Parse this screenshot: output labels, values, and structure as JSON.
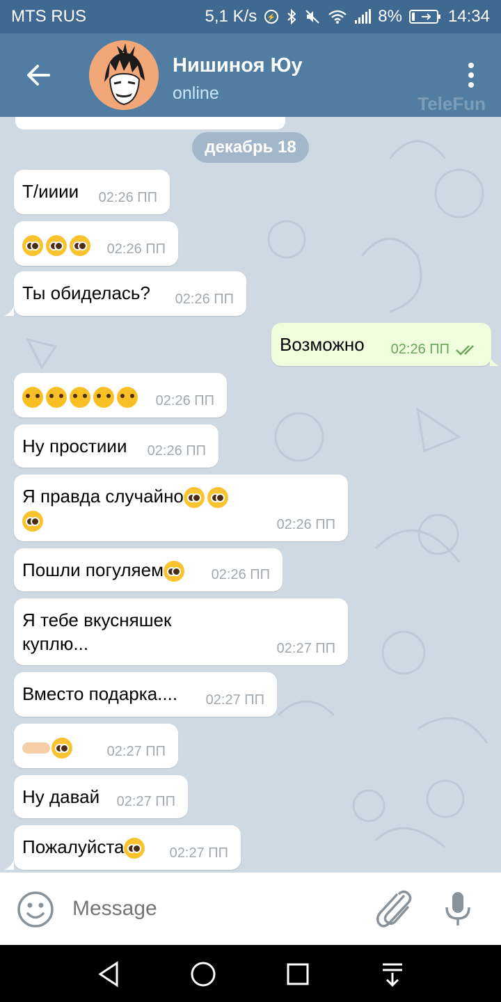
{
  "status_bar": {
    "carrier": "MTS RUS",
    "speed": "5,1 K/s",
    "battery": "8%",
    "time": "14:34",
    "icons": [
      "speed-icon",
      "bluetooth-icon",
      "mute-icon",
      "wifi-icon",
      "signal-icon",
      "battery-icon"
    ]
  },
  "header": {
    "title": "Нишиноя Юу",
    "status": "online",
    "watermark": "TeleFun"
  },
  "chat": {
    "date_divider": "декабрь 18",
    "messages": [
      {
        "text": "Т/ииии",
        "time": "02:26 ПП",
        "out": false
      },
      {
        "text": "",
        "emoji": [
          "pleading-face",
          "pleading-face",
          "pleading-face"
        ],
        "time": "02:26 ПП",
        "out": false
      },
      {
        "text": "Ты обиделась?",
        "time": "02:26 ПП",
        "out": false
      },
      {
        "text": "Возможно",
        "time": "02:26 ПП",
        "out": true,
        "status": "read"
      },
      {
        "text": "",
        "emoji": [
          "loudly-crying-face",
          "loudly-crying-face",
          "loudly-crying-face",
          "loudly-crying-face",
          "loudly-crying-face"
        ],
        "time": "02:26 ПП",
        "out": false
      },
      {
        "text": "Ну простиии",
        "time": "02:26 ПП",
        "out": false
      },
      {
        "text": "Я правда случайно",
        "emoji": [
          "pleading-face",
          "pleading-face",
          "pleading-face"
        ],
        "time": "02:26 ПП",
        "out": false
      },
      {
        "text": "Пошли погуляем",
        "emoji": [
          "pleading-face"
        ],
        "time": "02:26 ПП",
        "out": false
      },
      {
        "text_line1": "Я тебе вкусняшек",
        "text_line2": "куплю...",
        "time": "02:27 ПП",
        "out": false
      },
      {
        "text": "Вместо подарка....",
        "time": "02:27 ПП",
        "out": false
      },
      {
        "text": "",
        "emoji": [
          "pointing-fingers",
          "pleading-face"
        ],
        "time": "02:27 ПП",
        "out": false
      },
      {
        "text": "Ну давай",
        "time": "02:27 ПП",
        "out": false
      },
      {
        "text": "Пожалуйста",
        "emoji": [
          "pleading-face"
        ],
        "time": "02:27 ПП",
        "out": false
      }
    ]
  },
  "input": {
    "placeholder": "Message"
  },
  "colors": {
    "header": "#517da2",
    "status_bar": "#3f6990",
    "chat_bg": "#cfd9e3",
    "out_bubble": "#effedd",
    "time_gray": "#a0a8ae",
    "time_green": "#6aa45b"
  }
}
